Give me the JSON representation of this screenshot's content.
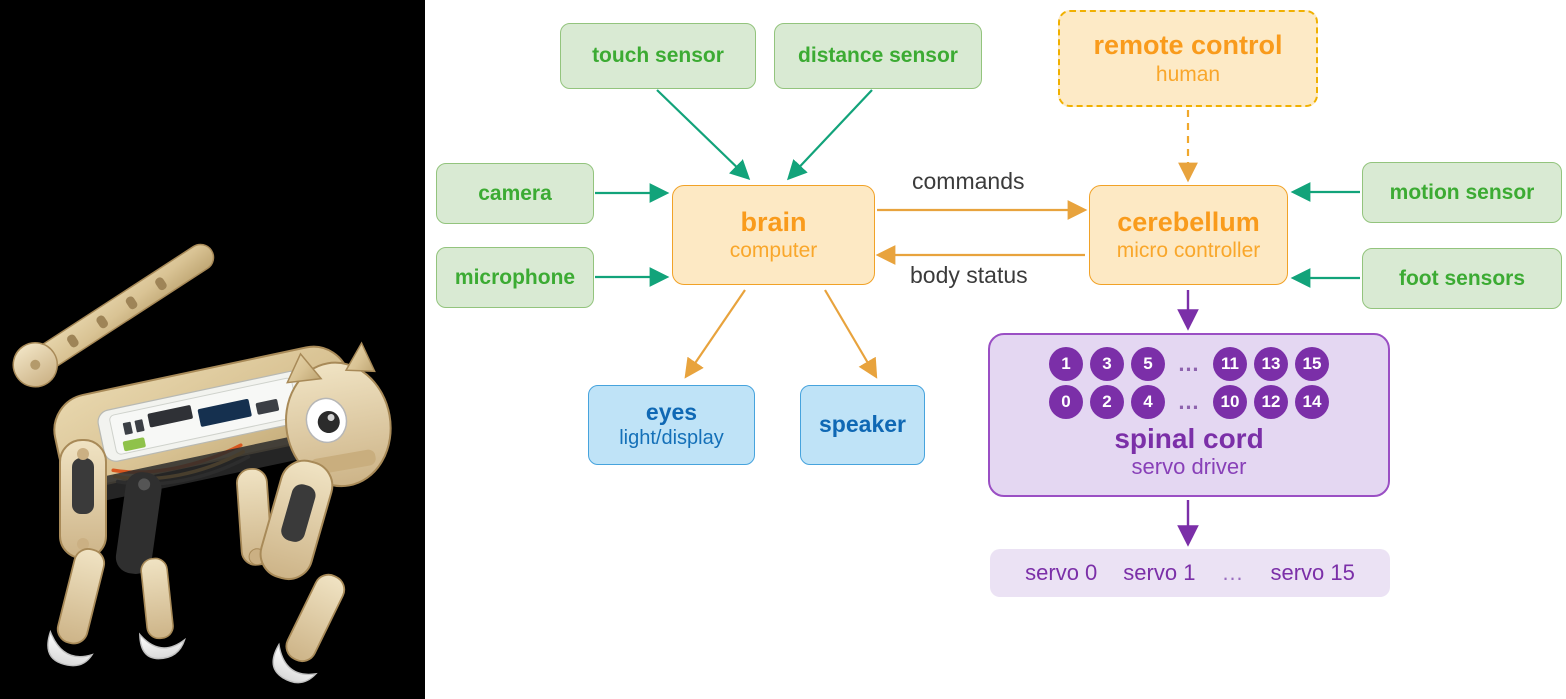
{
  "figure": {
    "kind": "robot-architecture-diagram",
    "photo_caption": "Petoi Nybble wooden robot cat (photo)"
  },
  "nodes": {
    "touch_sensor": {
      "label": "touch sensor"
    },
    "distance_sensor": {
      "label": "distance sensor"
    },
    "camera": {
      "label": "camera"
    },
    "microphone": {
      "label": "microphone"
    },
    "motion_sensor": {
      "label": "motion sensor"
    },
    "foot_sensors": {
      "label": "foot sensors"
    },
    "brain": {
      "title": "brain",
      "subtitle": "computer"
    },
    "cerebellum": {
      "title": "cerebellum",
      "subtitle": "micro controller"
    },
    "remote_control": {
      "title": "remote control",
      "subtitle": "human"
    },
    "eyes": {
      "title": "eyes",
      "subtitle": "light/display"
    },
    "speaker": {
      "title": "speaker",
      "subtitle": ""
    },
    "spinal_cord": {
      "title": "spinal cord",
      "subtitle": "servo driver",
      "row_top": [
        "1",
        "3",
        "5",
        "…",
        "11",
        "13",
        "15"
      ],
      "row_bottom": [
        "0",
        "2",
        "4",
        "…",
        "10",
        "12",
        "14"
      ]
    },
    "servo_list": {
      "items": [
        "servo 0",
        "servo 1"
      ],
      "dots": "…",
      "last": "servo 15"
    }
  },
  "edges": {
    "commands": "commands",
    "body_status": "body status"
  },
  "colors": {
    "sensor_fill": "#d9ead3",
    "sensor_stroke": "#93c47d",
    "sensor_text": "#3cab33",
    "sensor_arrow": "#12a37a",
    "brain_fill": "#fde9c4",
    "brain_stroke": "#f1a227",
    "brain_text": "#f99b1c",
    "orange_arrow": "#e8a33d",
    "output_fill": "#bfe3f7",
    "output_stroke": "#46a3dd",
    "output_text": "#0f68b4",
    "purple_fill": "#e4d7f2",
    "purple_stroke": "#9a4fc4",
    "purple_text": "#7b2fa8",
    "label_text": "#3b3b3b",
    "panel_bg": "#ffffff",
    "page_bg": "#000000"
  }
}
